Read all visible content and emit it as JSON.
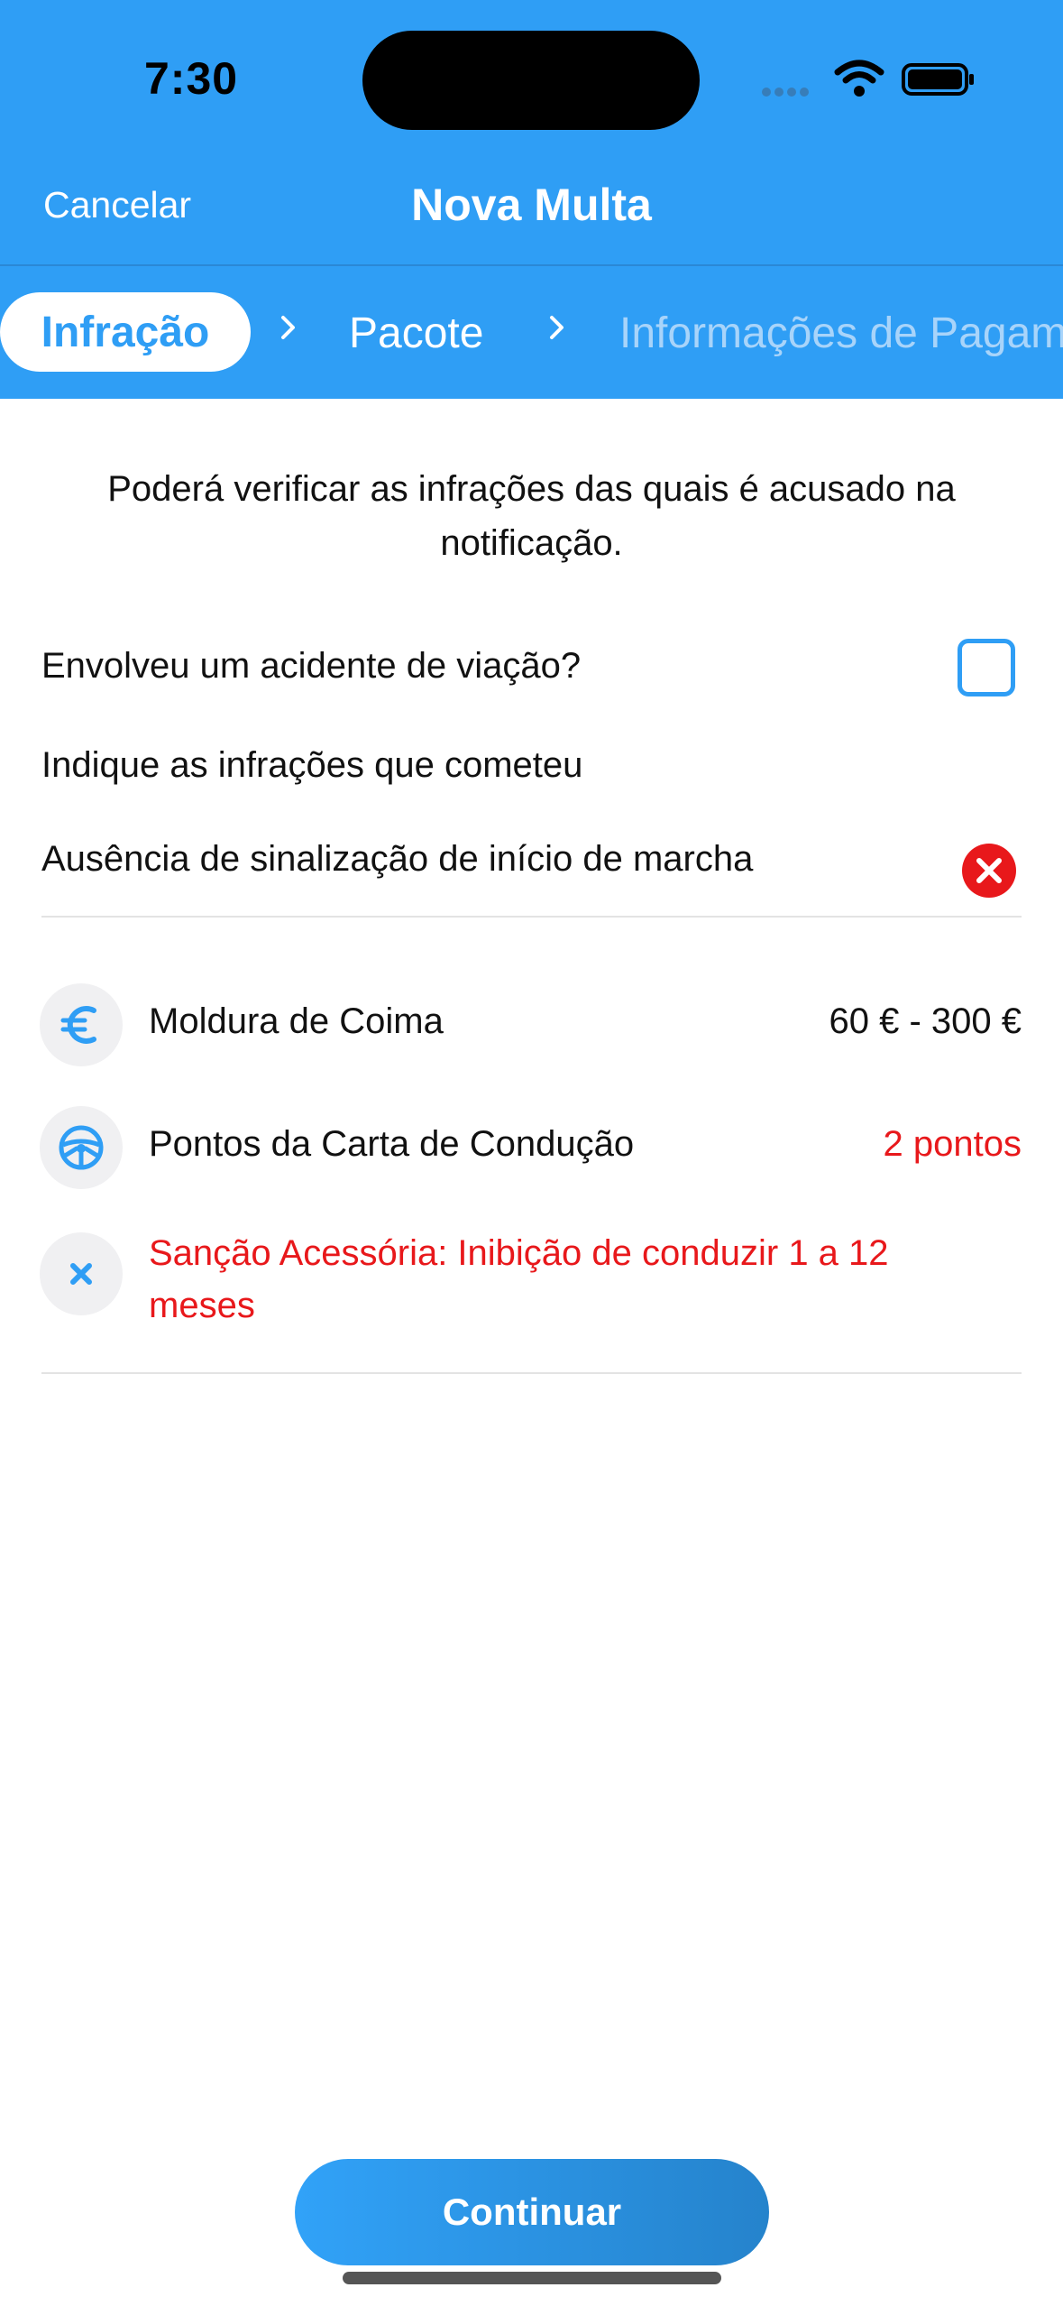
{
  "status_bar": {
    "time": "7:30"
  },
  "nav": {
    "cancel_label": "Cancelar",
    "title": "Nova Multa"
  },
  "steps": [
    {
      "label": "Infração",
      "active": true
    },
    {
      "label": "Pacote",
      "active": false
    },
    {
      "label": "Informações de Pagam",
      "active": false
    }
  ],
  "content": {
    "intro": "Poderá verificar as infrações das quais é acusado na notificação.",
    "accident_question": "Envolveu um acidente de viação?",
    "accident_checked": false,
    "infractions_heading": "Indique as infrações que cometeu",
    "selected_infraction": "Ausência de sinalização de início de marcha"
  },
  "details": {
    "fine_label": "Moldura de Coima",
    "fine_value": "60 € - 300 €",
    "points_label": "Pontos da Carta de Condução",
    "points_value": "2 pontos",
    "sanction": "Sanção Acessória: Inibição de conduzir 1 a 12 meses"
  },
  "footer": {
    "continue_label": "Continuar"
  },
  "colors": {
    "accent": "#2f9ef5",
    "danger": "#e8181b",
    "icon_bg": "#f0f0f2"
  },
  "icons": {
    "fine": "euro-icon",
    "points": "steering-wheel-icon",
    "sanction": "x-icon",
    "remove": "remove-circle-icon"
  }
}
